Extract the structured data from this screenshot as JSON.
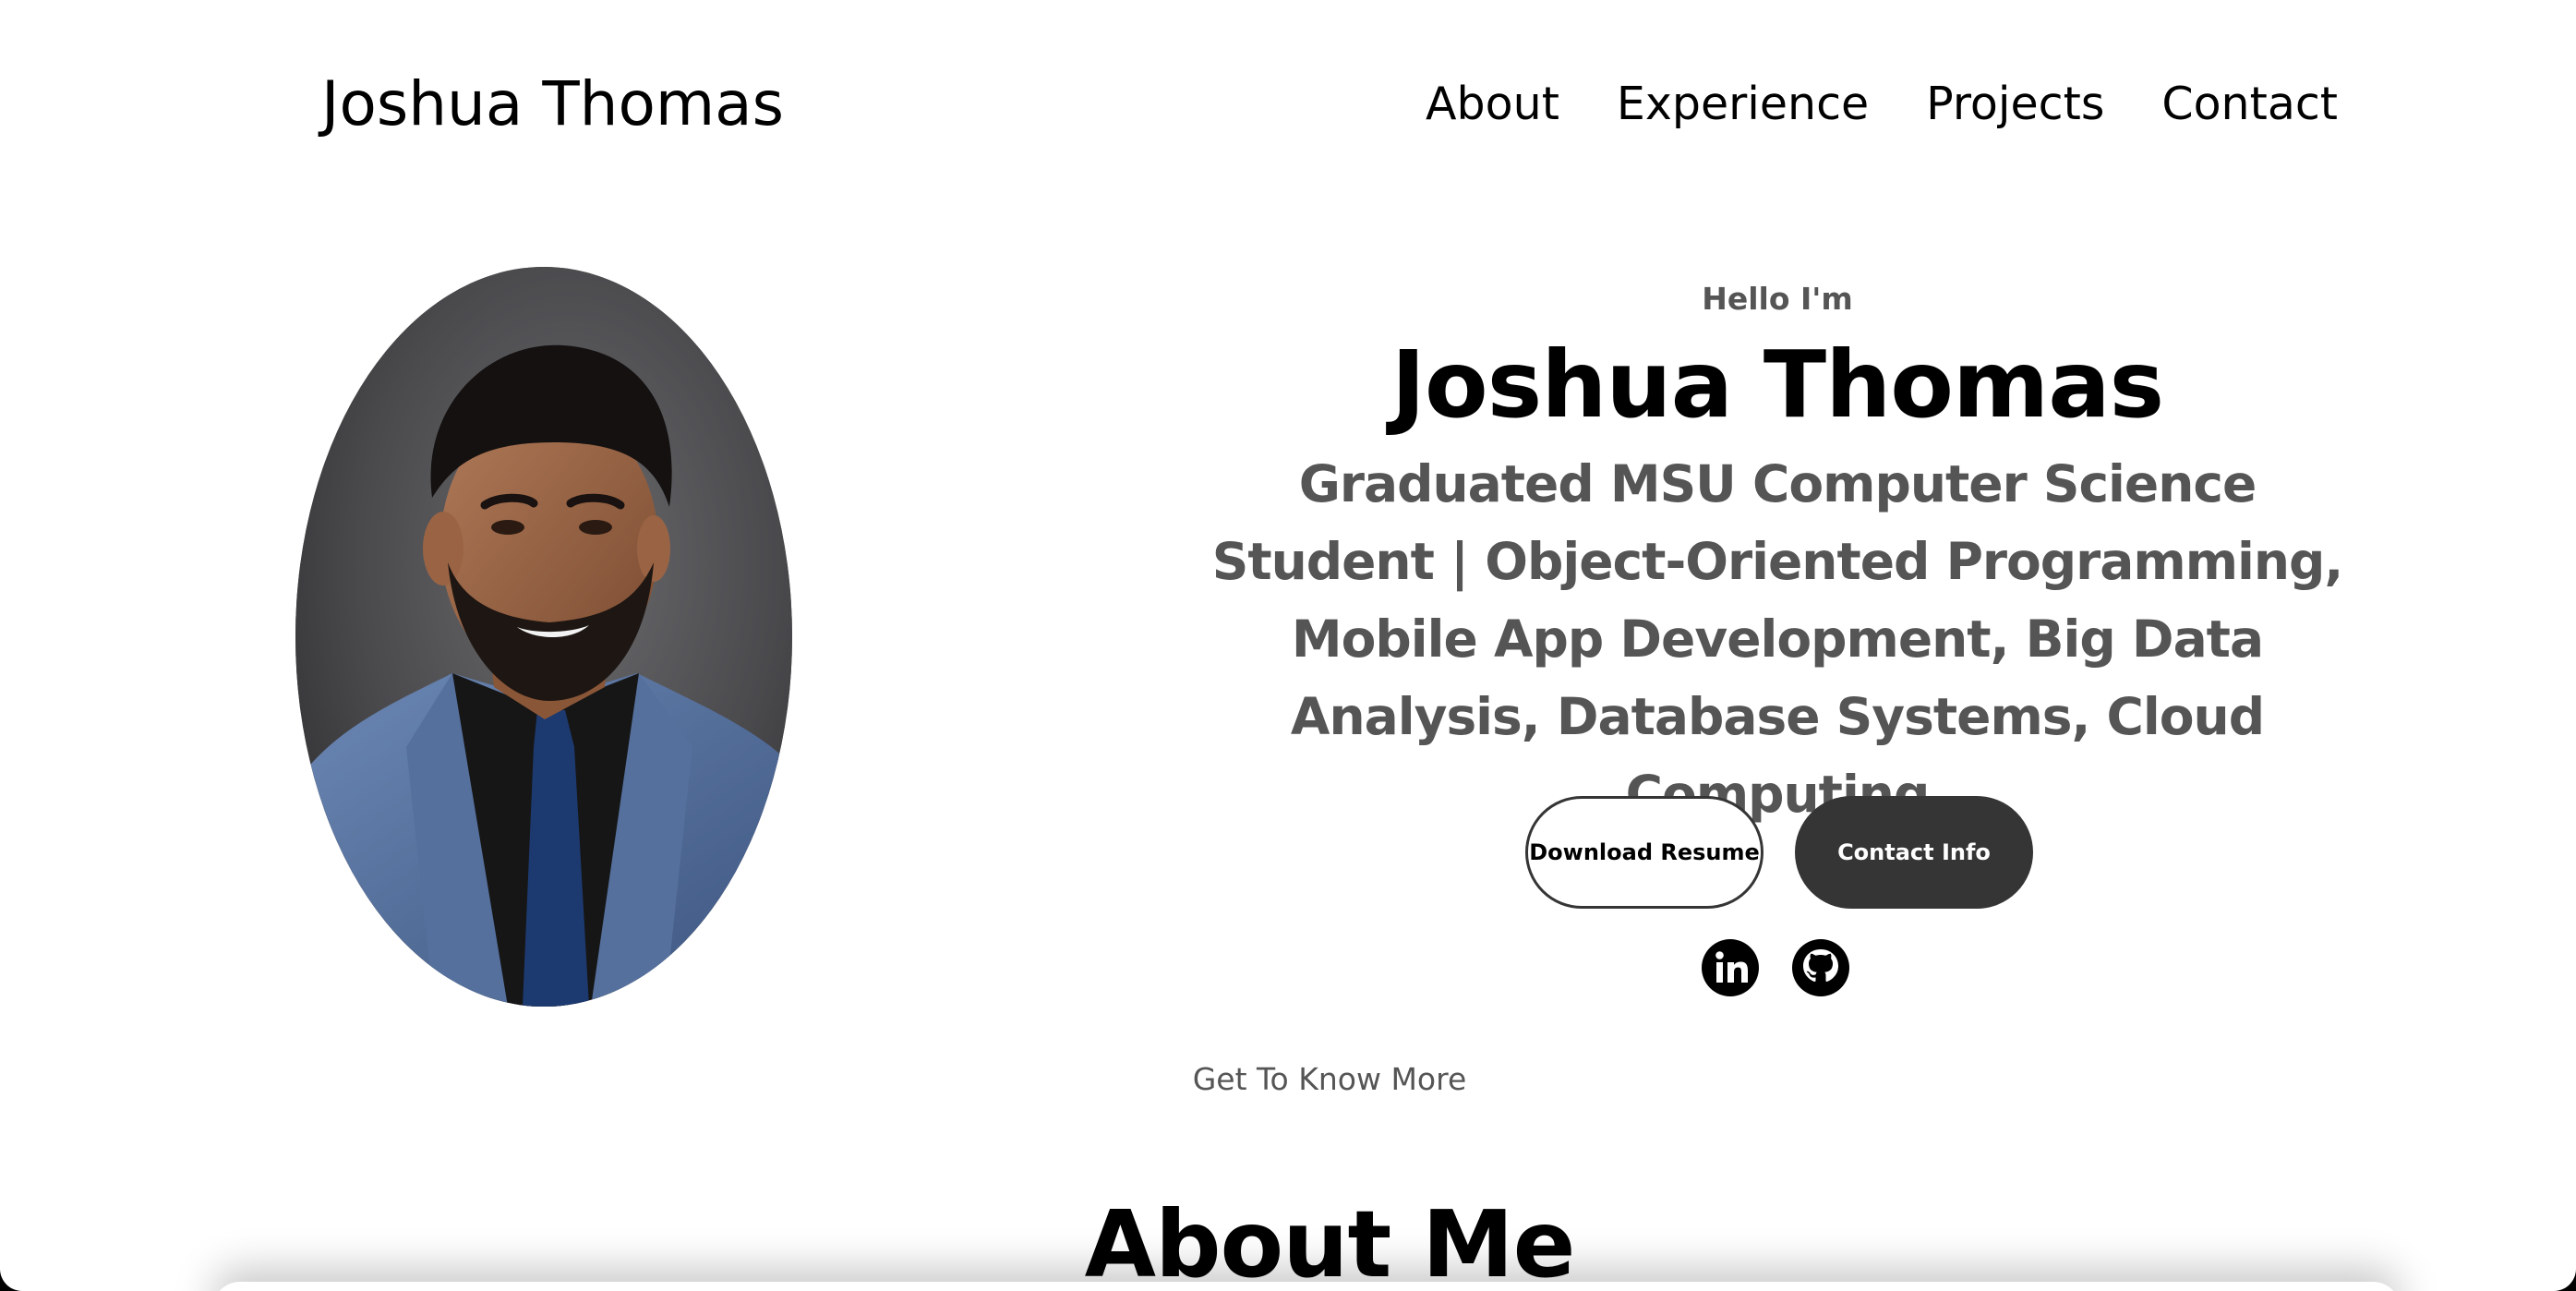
{
  "header": {
    "logo": "Joshua Thomas",
    "nav": [
      "About",
      "Experience",
      "Projects",
      "Contact"
    ]
  },
  "hero": {
    "greeting": "Hello I'm",
    "name": "Joshua Thomas",
    "tagline": "Graduated MSU Computer Science Student | Object-Oriented Programming, Mobile App Development, Big Data Analysis, Database Systems, Cloud Computing",
    "buttons": {
      "resume": "Download Resume",
      "contact": "Contact Info"
    },
    "socials": [
      "linkedin-icon",
      "github-icon"
    ]
  },
  "about": {
    "subtitle": "Get To Know More",
    "title": "About Me"
  },
  "colors": {
    "text_primary": "#000000",
    "text_secondary": "#555555",
    "button_dark": "#353535",
    "background": "#ffffff"
  }
}
